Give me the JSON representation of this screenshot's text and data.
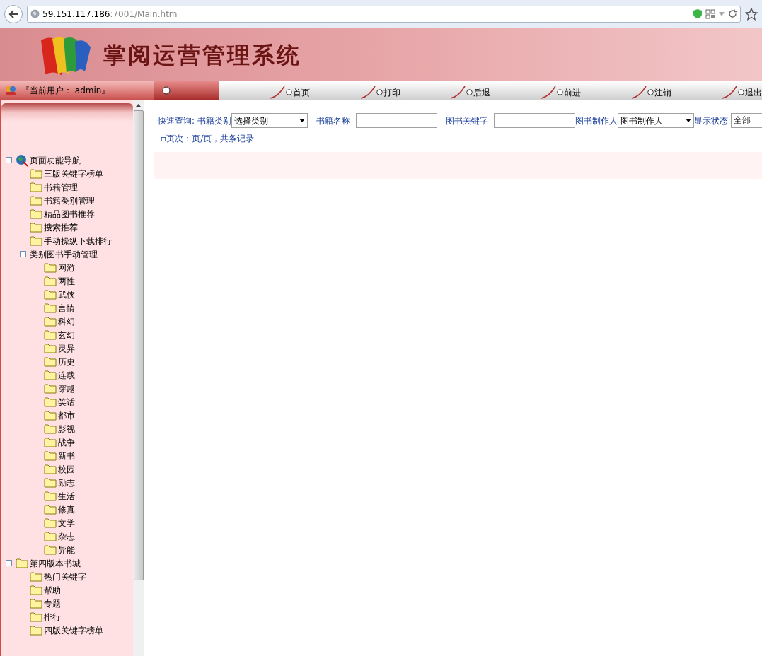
{
  "browser": {
    "url_host": "59.151.117.186",
    "url_rest": ":7001/Main.htm"
  },
  "banner": {
    "title": "掌阅运营管理系统"
  },
  "user_label": "『当前用户： admin』",
  "nav": [
    "首页",
    "打印",
    "后退",
    "前进",
    "注销",
    "退出"
  ],
  "tree": [
    {
      "label": "页面功能导航",
      "kind": "globe",
      "expanded": true,
      "children": [
        {
          "label": "三版关键字榜单",
          "kind": "folder"
        },
        {
          "label": "书籍管理",
          "kind": "folder"
        },
        {
          "label": "书籍类别管理",
          "kind": "folder"
        },
        {
          "label": "精品图书推荐",
          "kind": "folder"
        },
        {
          "label": "搜索推荐",
          "kind": "folder"
        },
        {
          "label": "手动操纵下载排行",
          "kind": "folder"
        },
        {
          "label": "类别图书手动管理",
          "kind": "none",
          "expanded": true,
          "children": [
            {
              "label": "网游",
              "kind": "folder"
            },
            {
              "label": "两性",
              "kind": "folder"
            },
            {
              "label": "武侠",
              "kind": "folder"
            },
            {
              "label": "言情",
              "kind": "folder"
            },
            {
              "label": "科幻",
              "kind": "folder"
            },
            {
              "label": "玄幻",
              "kind": "folder"
            },
            {
              "label": "灵异",
              "kind": "folder"
            },
            {
              "label": "历史",
              "kind": "folder"
            },
            {
              "label": "连载",
              "kind": "folder"
            },
            {
              "label": "穿越",
              "kind": "folder"
            },
            {
              "label": "笑话",
              "kind": "folder"
            },
            {
              "label": "都市",
              "kind": "folder"
            },
            {
              "label": "影视",
              "kind": "folder"
            },
            {
              "label": "战争",
              "kind": "folder"
            },
            {
              "label": "新书",
              "kind": "folder"
            },
            {
              "label": "校园",
              "kind": "folder"
            },
            {
              "label": "励志",
              "kind": "folder"
            },
            {
              "label": "生活",
              "kind": "folder"
            },
            {
              "label": "修真",
              "kind": "folder"
            },
            {
              "label": "文学",
              "kind": "folder"
            },
            {
              "label": "杂志",
              "kind": "folder"
            },
            {
              "label": "异能",
              "kind": "folder"
            }
          ]
        }
      ]
    },
    {
      "label": "第四版本书城",
      "kind": "folder",
      "expanded": true,
      "children": [
        {
          "label": "热门关键字",
          "kind": "folder"
        },
        {
          "label": "帮助",
          "kind": "folder"
        },
        {
          "label": "专题",
          "kind": "folder"
        },
        {
          "label": "排行",
          "kind": "folder"
        },
        {
          "label": "四版关键字榜单",
          "kind": "folder"
        }
      ]
    }
  ],
  "search": [
    {
      "kind": "select",
      "label": "快速查询: 书籍类别",
      "value": "选择类别"
    },
    {
      "kind": "input",
      "label": "书籍名称"
    },
    {
      "kind": "input",
      "label": "图书关键字"
    },
    {
      "kind": "select",
      "label": "图书制作人",
      "value": "图书制作人"
    },
    {
      "kind": "input",
      "label": "显示状态",
      "value": "全部"
    }
  ],
  "pager": "▫页次：页/页，共条记录"
}
